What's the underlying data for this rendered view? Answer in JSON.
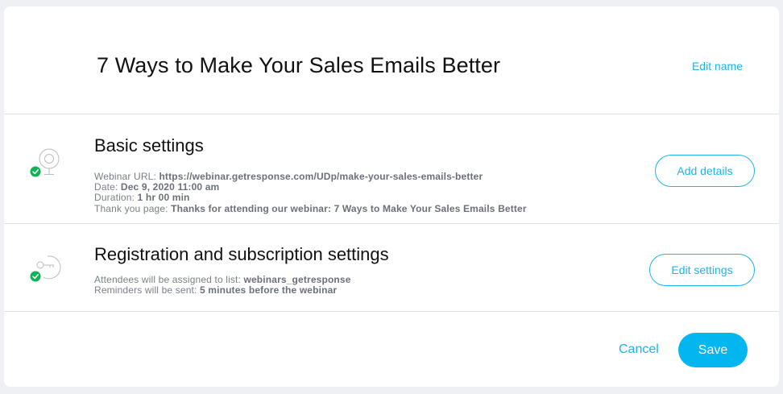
{
  "header": {
    "title": "7 Ways to Make Your Sales Emails Better",
    "edit_name_label": "Edit name"
  },
  "basic_settings": {
    "title": "Basic settings",
    "icon": "webcam-icon",
    "status": "completed",
    "url_label": "Webinar URL:",
    "url_value": "https://webinar.getresponse.com/UDp/make-your-sales-emails-better",
    "date_label": "Date:",
    "date_value": "Dec 9, 2020 11:00 am",
    "duration_label": "Duration:",
    "duration_value": "1 hr 00 min",
    "thankyou_label": "Thank you page:",
    "thankyou_value": "Thanks for attending our webinar: 7 Ways to Make Your Sales Emails Better",
    "button_label": "Add details"
  },
  "registration_settings": {
    "title": "Registration and subscription settings",
    "icon": "key-icon",
    "status": "completed",
    "list_label": "Attendees will be assigned to list:",
    "list_value": "webinars_getresponse",
    "reminders_label": "Reminders will be sent:",
    "reminders_value": "5 minutes before the webinar",
    "button_label": "Edit settings"
  },
  "footer": {
    "cancel_label": "Cancel",
    "save_label": "Save"
  },
  "colors": {
    "accent": "#1ab5ea",
    "save_button": "#04b6f0",
    "success": "#10b256",
    "background": "#eef0f3"
  }
}
